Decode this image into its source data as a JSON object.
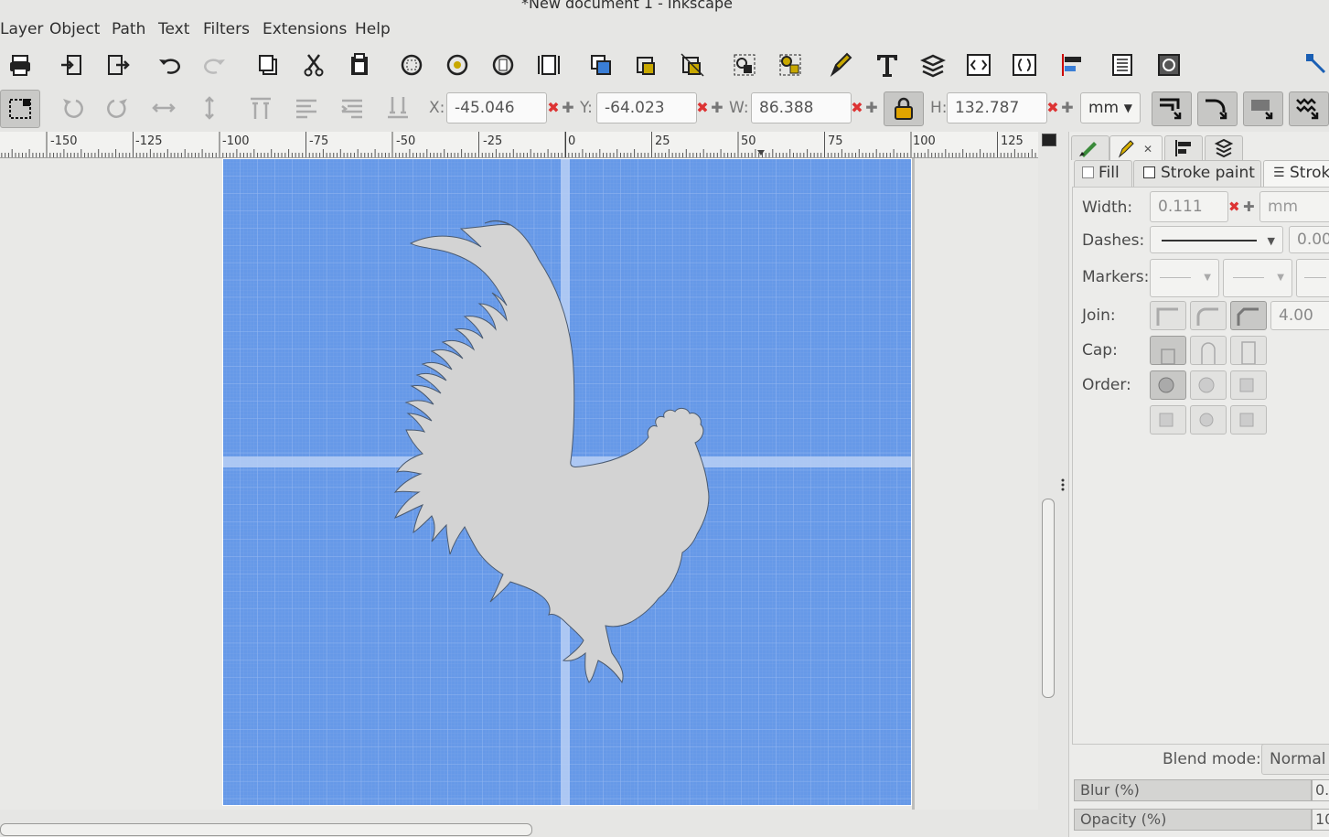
{
  "window": {
    "title": "*New document 1 - Inkscape"
  },
  "menu": [
    "Layer",
    "Object",
    "Path",
    "Text",
    "Filters",
    "Extensions",
    "Help"
  ],
  "toolbar": {
    "x_label": "X:",
    "x_value": "-45.046",
    "y_label": "Y:",
    "y_value": "-64.023",
    "w_label": "W:",
    "w_value": "86.388",
    "h_label": "H:",
    "h_value": "132.787",
    "unit": "mm"
  },
  "ruler": {
    "labels": [
      "-150",
      "-125",
      "-100",
      "-75",
      "-50",
      "-25",
      "0",
      "25",
      "50",
      "75",
      "100",
      "125"
    ]
  },
  "panel": {
    "tabs": {
      "fill": "Fill",
      "stroke_paint": "Stroke paint",
      "stroke_style": "Strok"
    },
    "width_label": "Width:",
    "width_value": "0.111",
    "width_unit": "mm",
    "dashes_label": "Dashes:",
    "dashes_value": "0.00",
    "markers_label": "Markers:",
    "join_label": "Join:",
    "join_value": "4.00",
    "cap_label": "Cap:",
    "order_label": "Order:",
    "blend_label": "Blend mode:",
    "blend_value": "Normal",
    "blur_label": "Blur (%)",
    "blur_value": "0.",
    "opacity_label": "Opacity (%)",
    "opacity_value": "10"
  },
  "colors": {
    "page": "#6699e8",
    "shape": "#d3d3d3",
    "grid": "#9cbdf2"
  }
}
